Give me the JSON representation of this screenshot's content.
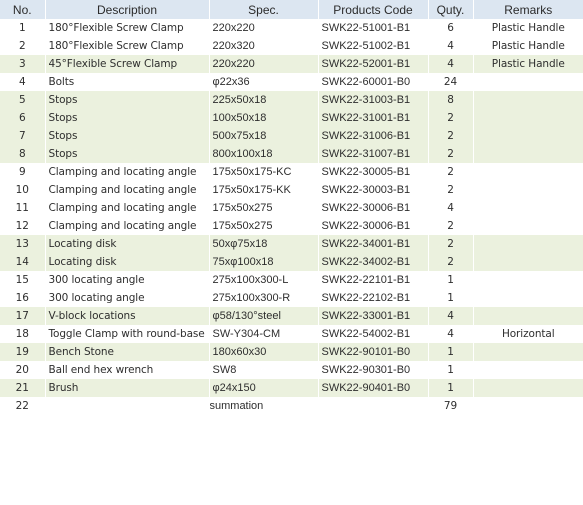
{
  "table": {
    "headers": {
      "no": "No.",
      "description": "Description",
      "spec": "Spec.",
      "code": "Products Code",
      "qty": "Quty.",
      "remarks": "Remarks"
    },
    "rows": [
      {
        "no": "1",
        "description": "180°Flexible Screw Clamp",
        "spec": "220x220",
        "code": "SWK22-51001-B1",
        "qty": "6",
        "remarks": "Plastic Handle",
        "shaded": false
      },
      {
        "no": "2",
        "description": "180°Flexible Screw Clamp",
        "spec": "220x320",
        "code": "SWK22-51002-B1",
        "qty": "4",
        "remarks": "Plastic Handle",
        "shaded": false
      },
      {
        "no": "3",
        "description": "45°Flexible Screw Clamp",
        "spec": "220x220",
        "code": "SWK22-52001-B1",
        "qty": "4",
        "remarks": "Plastic Handle",
        "shaded": true
      },
      {
        "no": "4",
        "description": "Bolts",
        "spec": "φ22x36",
        "code": "SWK22-60001-B0",
        "qty": "24",
        "remarks": "",
        "shaded": false
      },
      {
        "no": "5",
        "description": "Stops",
        "spec": "225x50x18",
        "code": "SWK22-31003-B1",
        "qty": "8",
        "remarks": "",
        "shaded": true
      },
      {
        "no": "6",
        "description": "Stops",
        "spec": "100x50x18",
        "code": "SWK22-31001-B1",
        "qty": "2",
        "remarks": "",
        "shaded": true
      },
      {
        "no": "7",
        "description": "Stops",
        "spec": "500x75x18",
        "code": "SWK22-31006-B1",
        "qty": "2",
        "remarks": "",
        "shaded": true
      },
      {
        "no": "8",
        "description": "Stops",
        "spec": "800x100x18",
        "code": "SWK22-31007-B1",
        "qty": "2",
        "remarks": "",
        "shaded": true
      },
      {
        "no": "9",
        "description": "Clamping and locating angle",
        "spec": "175x50x175-KC",
        "code": "SWK22-30005-B1",
        "qty": "2",
        "remarks": "",
        "shaded": false
      },
      {
        "no": "10",
        "description": "Clamping and locating angle",
        "spec": "175x50x175-KK",
        "code": "SWK22-30003-B1",
        "qty": "2",
        "remarks": "",
        "shaded": false
      },
      {
        "no": "11",
        "description": "Clamping and locating angle",
        "spec": "175x50x275",
        "code": "SWK22-30006-B1",
        "qty": "4",
        "remarks": "",
        "shaded": false
      },
      {
        "no": "12",
        "description": "Clamping and locating angle",
        "spec": "175x50x275",
        "code": "SWK22-30006-B1",
        "qty": "2",
        "remarks": "",
        "shaded": false
      },
      {
        "no": "13",
        "description": "Locating disk",
        "spec": "50xφ75x18",
        "code": "SWK22-34001-B1",
        "qty": "2",
        "remarks": "",
        "shaded": true
      },
      {
        "no": "14",
        "description": "Locating disk",
        "spec": "75xφ100x18",
        "code": "SWK22-34002-B1",
        "qty": "2",
        "remarks": "",
        "shaded": true
      },
      {
        "no": "15",
        "description": "300 locating angle",
        "spec": "275x100x300-L",
        "code": "SWK22-22101-B1",
        "qty": "1",
        "remarks": "",
        "shaded": false
      },
      {
        "no": "16",
        "description": "300 locating angle",
        "spec": "275x100x300-R",
        "code": "SWK22-22102-B1",
        "qty": "1",
        "remarks": "",
        "shaded": false
      },
      {
        "no": "17",
        "description": "V-block locations",
        "spec": "φ58/130°steel",
        "code": "SWK22-33001-B1",
        "qty": "4",
        "remarks": "",
        "shaded": true
      },
      {
        "no": "18",
        "description": "Toggle Clamp with round-base",
        "spec": "SW-Y304-CM",
        "code": "SWK22-54002-B1",
        "qty": "4",
        "remarks": "Horizontal",
        "shaded": false
      },
      {
        "no": "19",
        "description": "Bench Stone",
        "spec": "180x60x30",
        "code": "SWK22-90101-B0",
        "qty": "1",
        "remarks": "",
        "shaded": true
      },
      {
        "no": "20",
        "description": "Ball end hex wrench",
        "spec": "SW8",
        "code": "SWK22-90301-B0",
        "qty": "1",
        "remarks": "",
        "shaded": false
      },
      {
        "no": "21",
        "description": "Brush",
        "spec": "φ24x150",
        "code": "SWK22-90401-B0",
        "qty": "1",
        "remarks": "",
        "shaded": true
      }
    ],
    "summary": {
      "no": "22",
      "label": "summation",
      "total_qty": "79"
    }
  },
  "colors": {
    "header_bg": "#dce6f1",
    "shaded_row_bg": "#ebf1de",
    "text": "#2e2e2e"
  }
}
